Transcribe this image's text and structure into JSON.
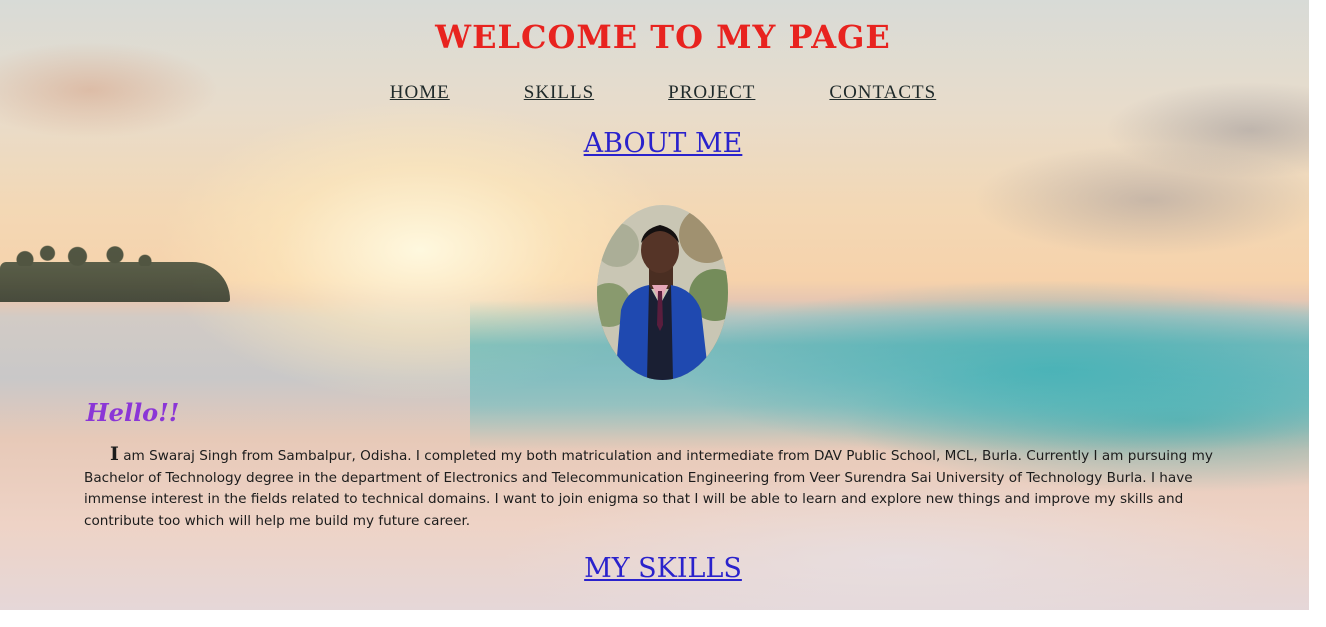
{
  "header": {
    "title": "WELCOME TO MY PAGE"
  },
  "nav": {
    "items": [
      {
        "label": "HOME"
      },
      {
        "label": "SKILLS"
      },
      {
        "label": "PROJECT"
      },
      {
        "label": "CONTACTS"
      }
    ]
  },
  "about": {
    "heading": "ABOUT ME",
    "greeting": "Hello!!",
    "bio_first_letter": "I",
    "bio_rest": " am Swaraj Singh from Sambalpur, Odisha. I completed my both matriculation and intermediate from DAV Public School, MCL, Burla. Currently I am pursuing my Bachelor of Technology degree in the department of Electronics and Telecommunication Engineering from Veer Surendra Sai University of Technology Burla. I have immense interest in the fields related to technical domains. I want to join enigma so that I will be able to learn and explore new things and improve my skills and contribute too which will help me build my future career."
  },
  "skills": {
    "heading": "MY SKILLS"
  },
  "colors": {
    "title": "#e8231f",
    "link_heading": "#2a22cc",
    "greeting": "#8b36d6",
    "nav_text": "#1f2a2a"
  }
}
